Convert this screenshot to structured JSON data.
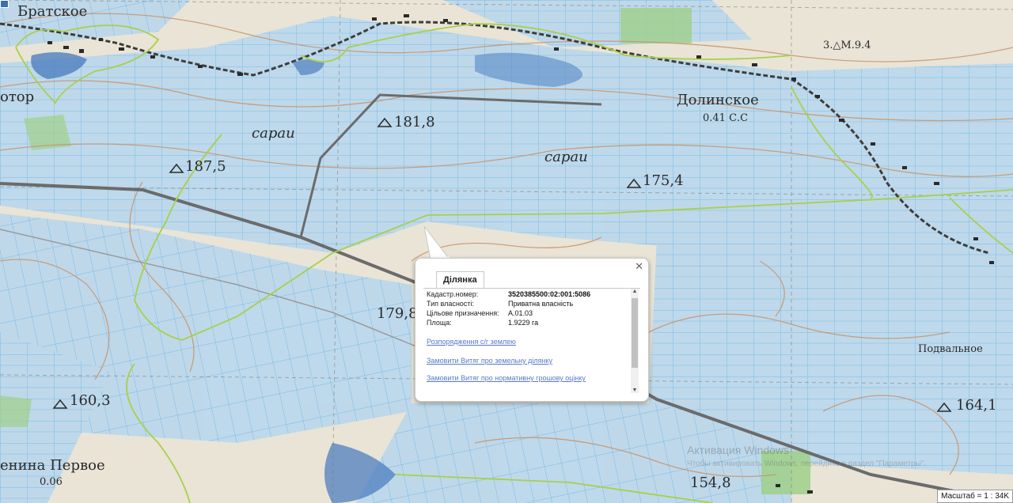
{
  "map": {
    "labels": [
      {
        "id": "bratskoe",
        "text": "Братское"
      },
      {
        "id": "dolinskoe",
        "text": "Долинское"
      },
      {
        "id": "dolinskoe_sub",
        "text": "0.41 С.С"
      },
      {
        "id": "saray1",
        "text": "сараи"
      },
      {
        "id": "saray2",
        "text": "сараи"
      },
      {
        "id": "h1818",
        "text": "181,8"
      },
      {
        "id": "h1875",
        "text": "187,5"
      },
      {
        "id": "h1754",
        "text": "175,4"
      },
      {
        "id": "h1798",
        "text": "179,8"
      },
      {
        "id": "h1603",
        "text": "160,3"
      },
      {
        "id": "h1548",
        "text": "154,8"
      },
      {
        "id": "h164",
        "text": "164,1"
      },
      {
        "id": "lenina",
        "text": "енина Первое"
      },
      {
        "id": "lenina_sub",
        "text": "0.06"
      },
      {
        "id": "podvalnoe",
        "text": "Подвальное"
      },
      {
        "id": "otor",
        "text": "отор"
      },
      {
        "id": "m94",
        "text": "3.△М.9.4"
      }
    ],
    "colors": {
      "paper": "#eae6d8",
      "parcel_fill": "#bcd8ec",
      "parcel_line": "#72b8e8",
      "boundary": "#a8d048",
      "road": "#6b6b6b",
      "contour": "#c9936a",
      "water": "#4e7fbf",
      "forest": "#8fc87a"
    }
  },
  "popup": {
    "close_icon": "close-icon",
    "tab_label": "Ділянка",
    "fields": [
      {
        "key": "Кадастр.номер:",
        "value": "3520385500:02:001:5086"
      },
      {
        "key": "Тип власності:",
        "value": "Приватна власність"
      },
      {
        "key": "Цільове призначення:",
        "value": "А.01.03"
      },
      {
        "key": "Площа:",
        "value": "1.9229 га"
      }
    ],
    "links": [
      "Розпорядження с/г землею",
      "Замовити Витяг про земельну ділянку",
      "Замовити Витяг про нормативну грошову оцінку"
    ]
  },
  "scale": "Масштаб = 1 : 34K",
  "watermark": {
    "title": "Активация Windows",
    "subtitle": "Чтобы активировать Windows, перейдите в раздел \"Параметры\"."
  }
}
